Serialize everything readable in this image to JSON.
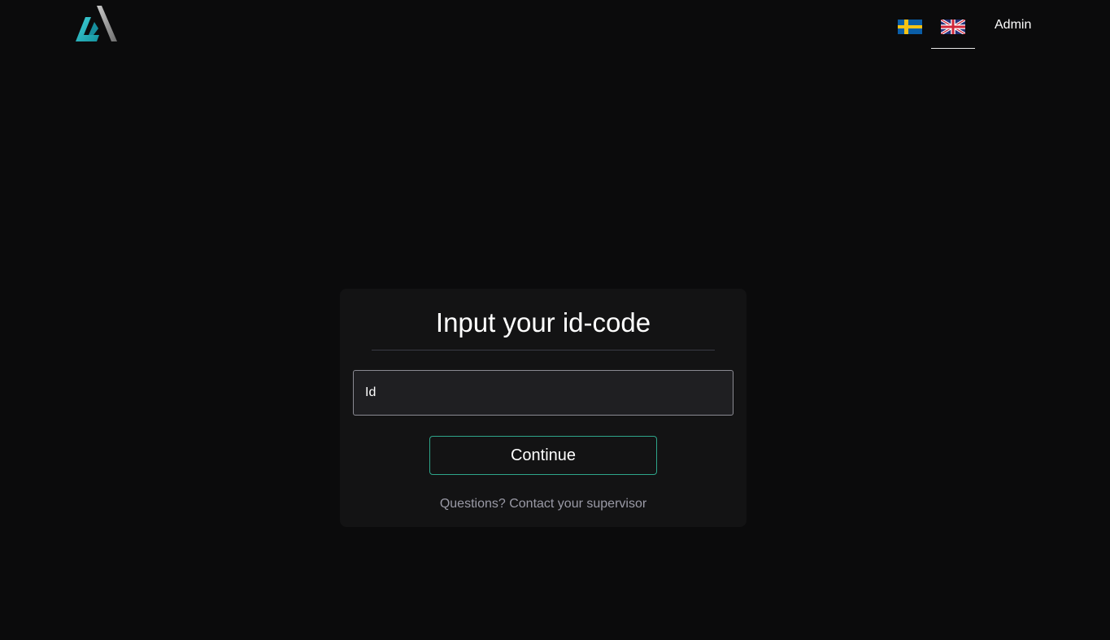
{
  "header": {
    "logo": {
      "icon": "brand-logo-icon"
    },
    "languages": [
      {
        "code": "sv",
        "icon": "sweden-flag-icon",
        "active": false
      },
      {
        "code": "en",
        "icon": "uk-flag-icon",
        "active": true
      }
    ],
    "admin_label": "Admin"
  },
  "login_card": {
    "title": "Input your id-code",
    "id_field": {
      "placeholder": "Id",
      "value": ""
    },
    "continue_label": "Continue",
    "help_text": "Questions? Contact your supervisor"
  },
  "colors": {
    "background": "#0b0b0c",
    "card_background": "#131314",
    "accent": "#2ea58a",
    "logo_teal": "#1aa6b7"
  }
}
